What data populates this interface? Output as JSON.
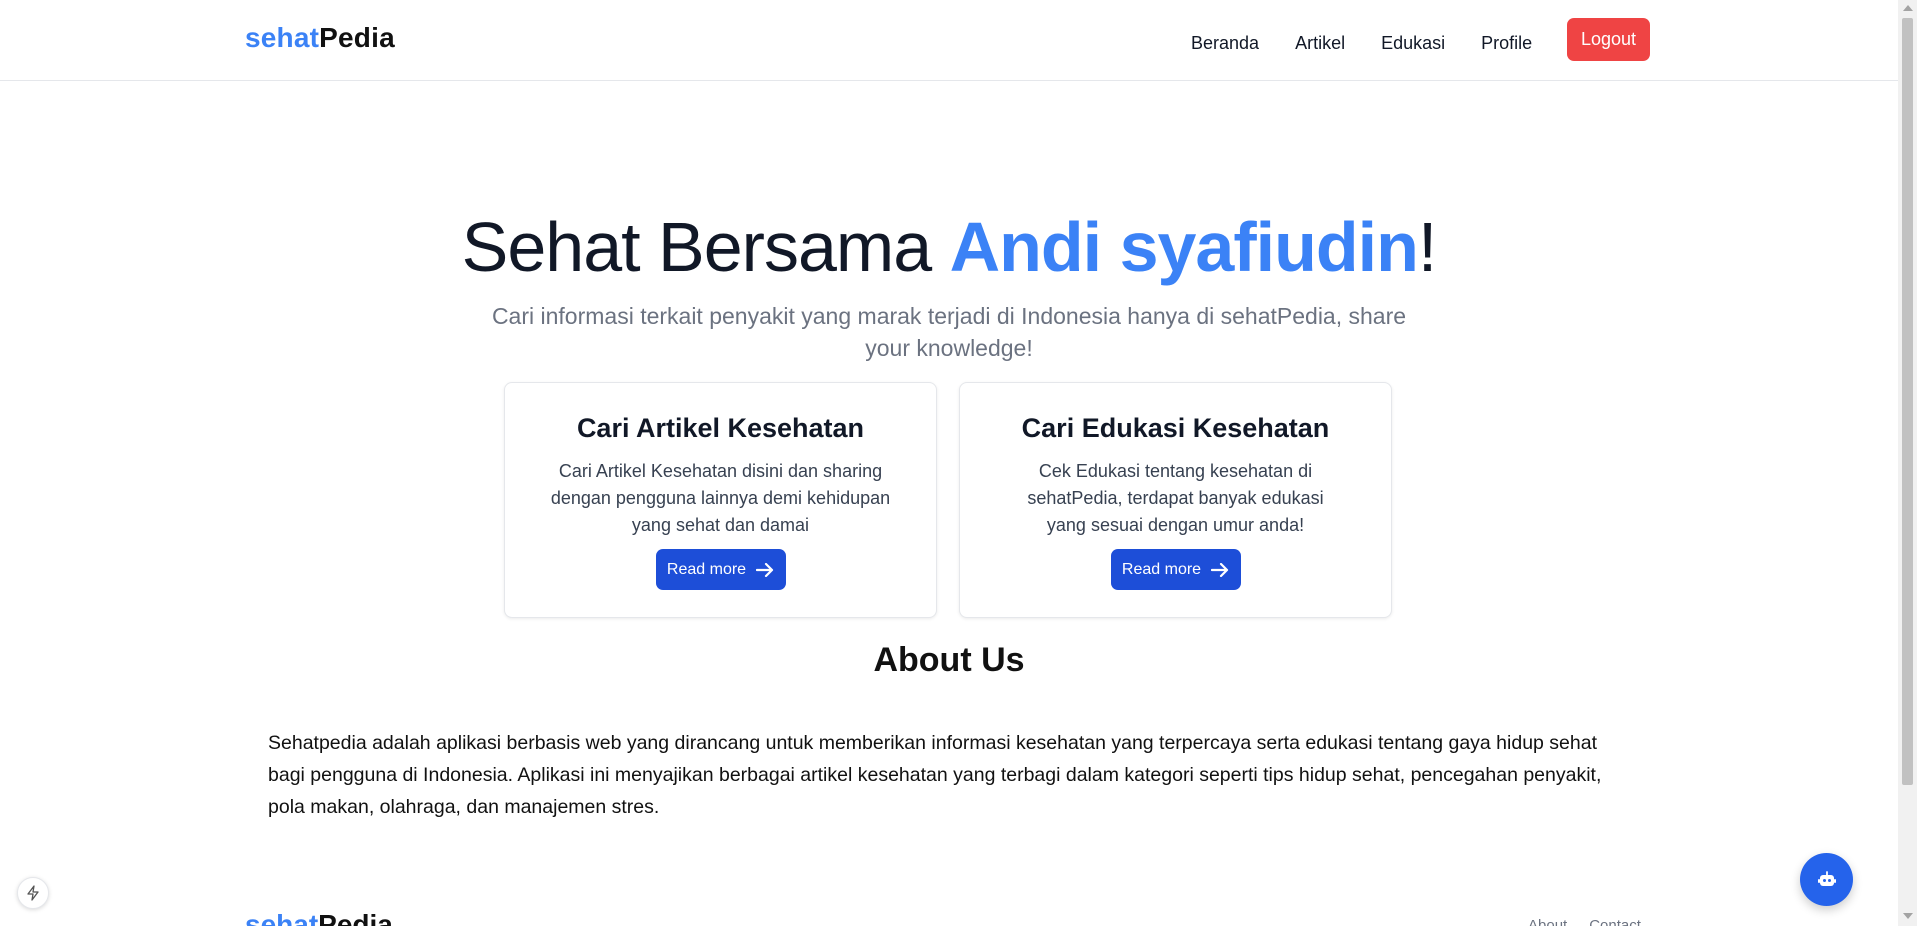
{
  "brand": {
    "part1": "sehat",
    "part2": "Pedia"
  },
  "nav": {
    "items": [
      {
        "label": "Beranda"
      },
      {
        "label": "Artikel"
      },
      {
        "label": "Edukasi"
      },
      {
        "label": "Profile"
      }
    ],
    "logout_label": "Logout"
  },
  "hero": {
    "title_prefix": "Sehat Bersama ",
    "user_name": "Andi syafiudin",
    "title_suffix": "!",
    "subtitle": "Cari informasi terkait penyakit yang marak terjadi di Indonesia hanya di sehatPedia, share your knowledge!"
  },
  "cards": [
    {
      "title": "Cari Artikel Kesehatan",
      "description": "Cari Artikel Kesehatan disini dan sharing dengan pengguna lainnya demi kehidupan yang sehat dan damai",
      "button_label": "Read more"
    },
    {
      "title": "Cari Edukasi Kesehatan",
      "description": "Cek Edukasi tentang kesehatan di sehatPedia, terdapat banyak edukasi yang sesuai dengan umur anda!",
      "button_label": "Read more"
    }
  ],
  "about": {
    "title": "About Us",
    "text": "Sehatpedia adalah aplikasi berbasis web yang dirancang untuk memberikan informasi kesehatan yang terpercaya serta edukasi tentang gaya hidup sehat bagi pengguna di Indonesia. Aplikasi ini menyajikan berbagai artikel kesehatan yang terbagi dalam kategori seperti tips hidup sehat, pencegahan penyakit, pola makan, olahraga, dan manajemen stres."
  },
  "footer": {
    "links": [
      {
        "label": "About"
      },
      {
        "label": "Contact"
      }
    ]
  },
  "icons": {
    "chat_fab": "robot-icon",
    "dev_badge": "lightning-icon",
    "read_more": "arrow-right-icon"
  },
  "colors": {
    "brand_blue": "#3b82f6",
    "button_blue": "#1d4ed8",
    "logout_red": "#ef4444",
    "fab_blue": "#2563eb"
  }
}
